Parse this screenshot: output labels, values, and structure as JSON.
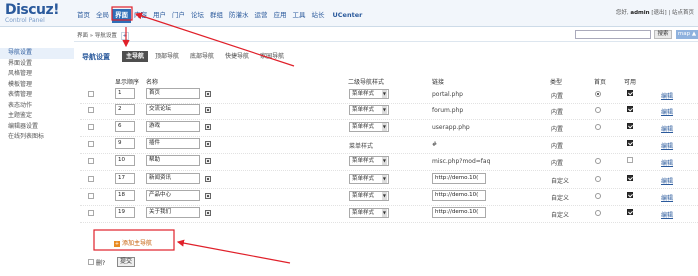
{
  "logo": {
    "main": "Discuz!",
    "sub": "Control Panel"
  },
  "nav": [
    "首页",
    "全局",
    "界面",
    "内容",
    "用户",
    "门户",
    "论坛",
    "群组",
    "防灌水",
    "运营",
    "应用",
    "工具",
    "站长",
    "UCenter"
  ],
  "user": {
    "prefix": "您好,",
    "name": "admin",
    "logout": "[退出]",
    "home": "站点首页"
  },
  "breadcrumb": {
    "path": "界面 » 导航设置",
    "plus": "+"
  },
  "search": {
    "button": "搜索",
    "map": "map ▲"
  },
  "sidebar": [
    "导航设置",
    "界面设置",
    "风格管理",
    "模板管理",
    "表情管理",
    "表态动作",
    "主题鉴定",
    "编辑器设置",
    "在线列表图标"
  ],
  "main": {
    "title": "导航设置",
    "tabs": [
      "主导航",
      "顶部导航",
      "底部导航",
      "快捷导航",
      "家园导航"
    ]
  },
  "headers": {
    "order": "显示顺序",
    "name": "名称",
    "subnav": "二级导航样式",
    "url": "链接",
    "type": "类型",
    "home": "首页",
    "enabled": "可用"
  },
  "rows": [
    {
      "order": "1",
      "name": "首页",
      "subnav": "菜单样式",
      "url": "portal.php",
      "type": "内置",
      "home": true,
      "enabled": true,
      "edit": "编辑"
    },
    {
      "order": "2",
      "name": "交流论坛",
      "subnav": "菜单样式",
      "url": "forum.php",
      "type": "内置",
      "home": false,
      "enabled": true,
      "edit": "编辑"
    },
    {
      "order": "6",
      "name": "游戏",
      "subnav": "菜单样式",
      "url": "userapp.php",
      "type": "内置",
      "home": false,
      "enabled": true,
      "edit": "编辑"
    },
    {
      "order": "9",
      "name": "插件",
      "subnav": "菜单样式",
      "url": "#",
      "type": "内置",
      "home": null,
      "enabled": true,
      "edit": "编辑"
    },
    {
      "order": "10",
      "name": "帮助",
      "subnav": "菜单样式",
      "url": "misc.php?mod=faq",
      "type": "内置",
      "home": false,
      "enabled": false,
      "edit": "编辑"
    },
    {
      "order": "17",
      "name": "新闻资讯",
      "subnav": "菜单样式",
      "url": "http://demo.10(",
      "type": "自定义",
      "home": false,
      "enabled": true,
      "edit": "编辑"
    },
    {
      "order": "18",
      "name": "产品中心",
      "subnav": "菜单样式",
      "url": "http://demo.10(",
      "type": "自定义",
      "home": false,
      "enabled": true,
      "edit": "编辑"
    },
    {
      "order": "19",
      "name": "关于我们",
      "subnav": "菜单样式",
      "url": "http://demo.10(",
      "type": "自定义",
      "home": false,
      "enabled": true,
      "edit": "编辑"
    }
  ],
  "footer": {
    "add": "添加主导航",
    "delete": "删?",
    "submit": "提交"
  },
  "colors": {
    "accent": "#2f6fb8",
    "annotation": "#e0202a"
  }
}
